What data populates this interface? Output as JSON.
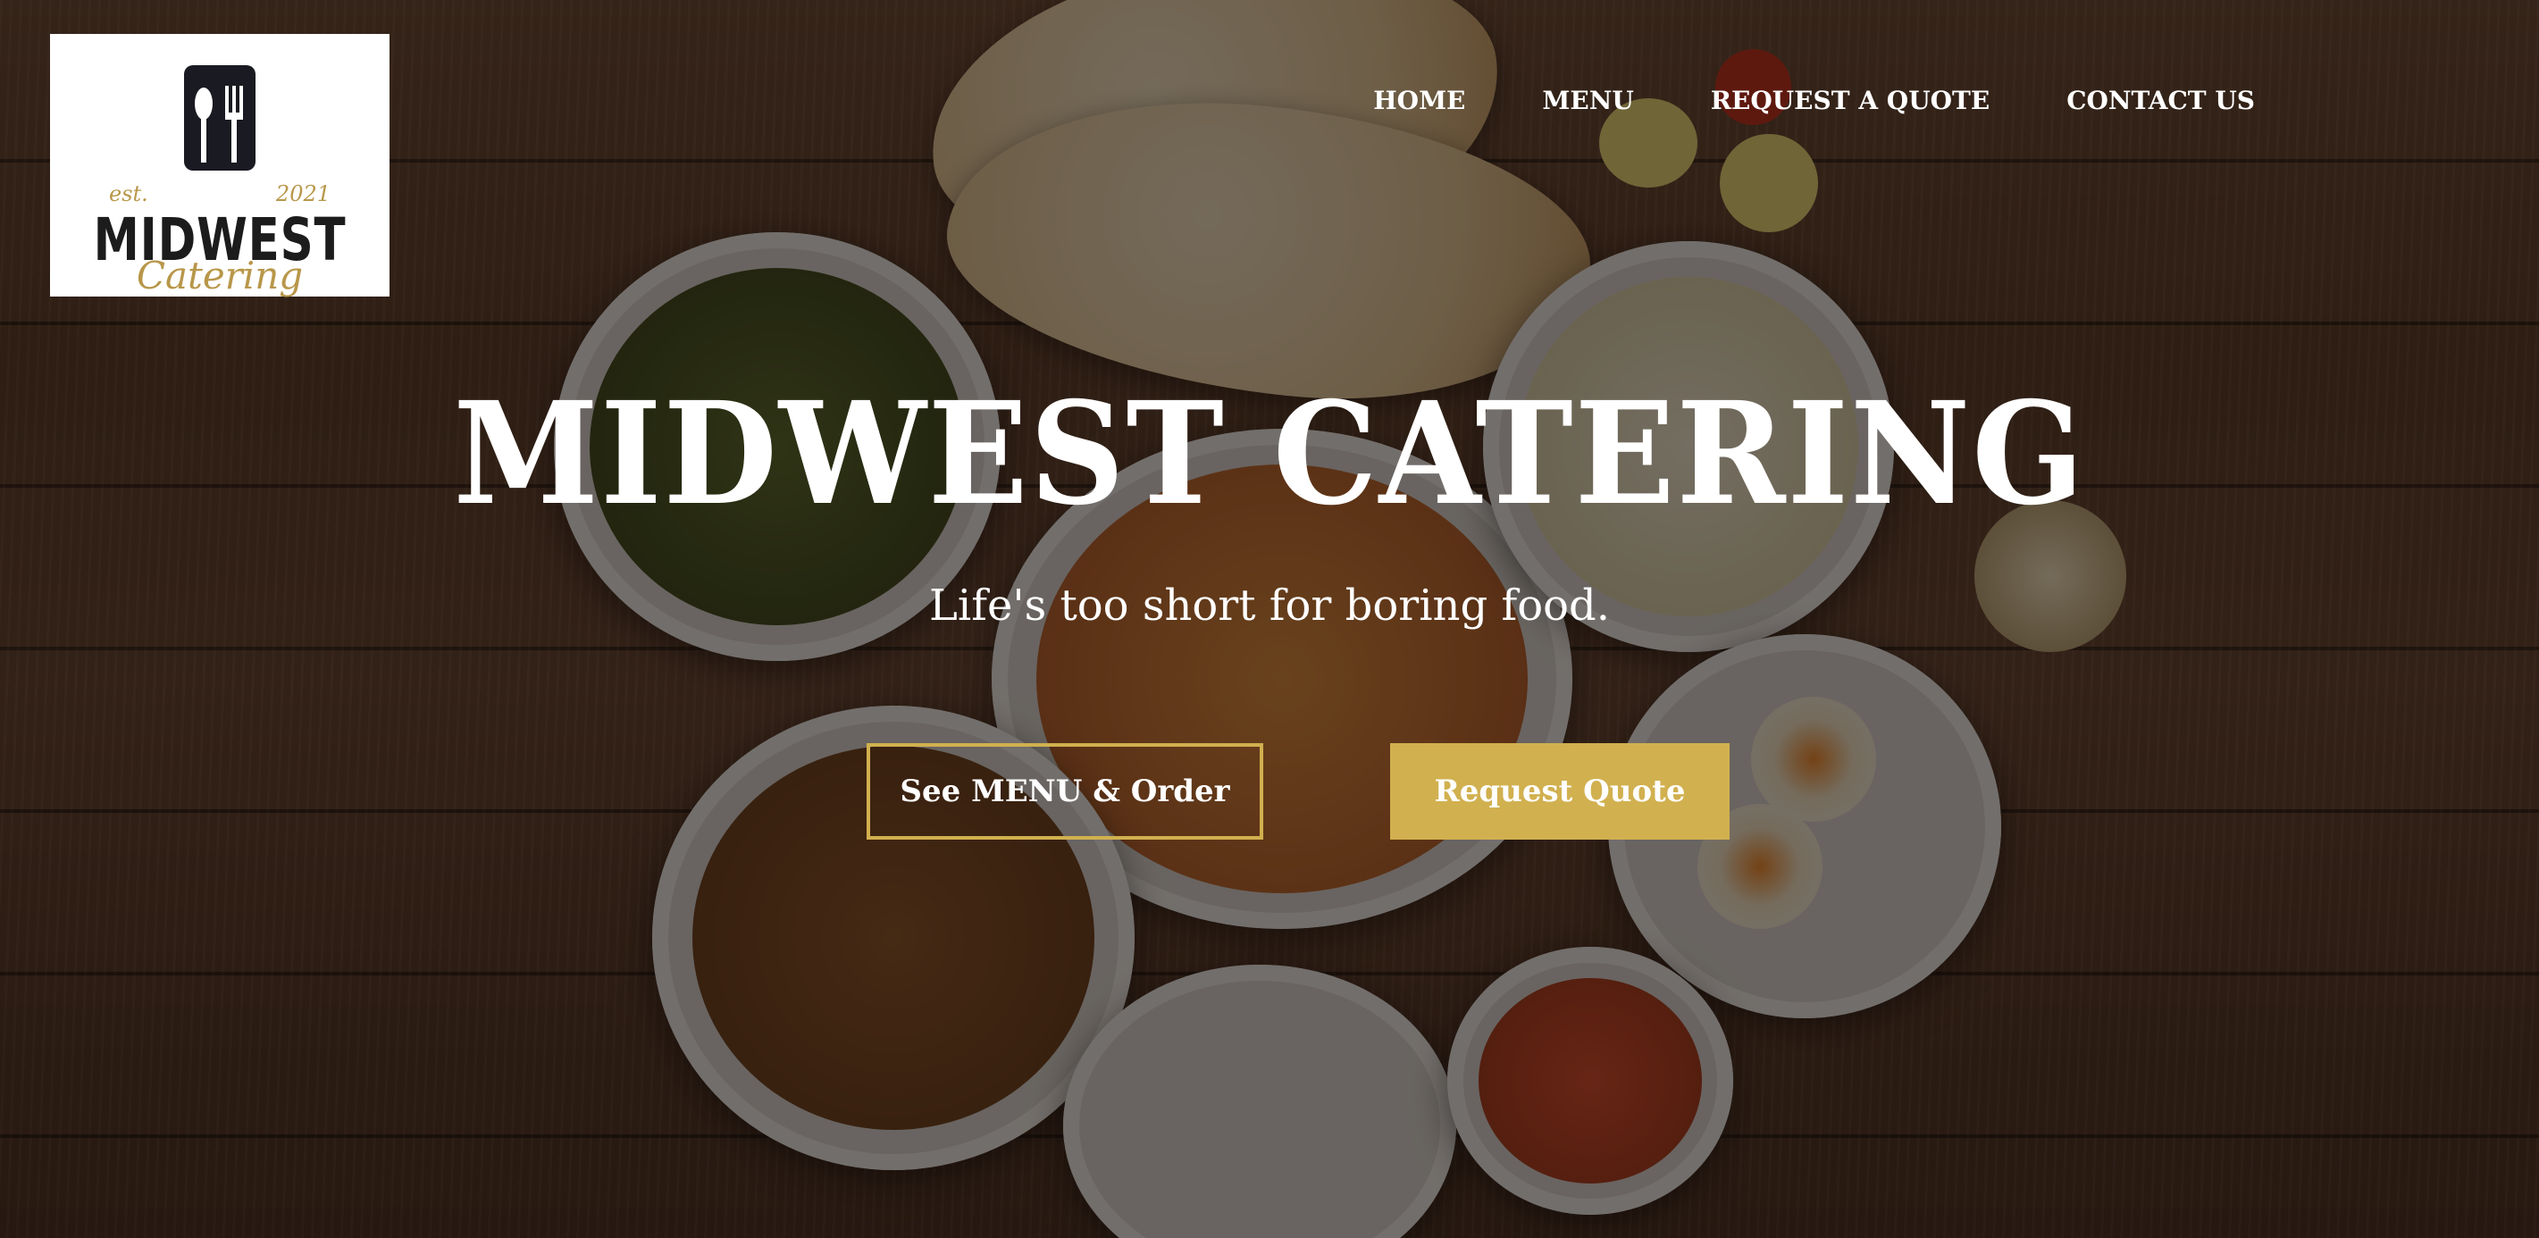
{
  "logo": {
    "brand": "MIDWEST",
    "sub": "Catering",
    "est": "est.",
    "year": "2021"
  },
  "nav": {
    "items": [
      "HOME",
      "MENU",
      "REQUEST A QUOTE",
      "CONTACT US"
    ]
  },
  "hero": {
    "title": "MIDWEST CATERING",
    "tagline": "Life's too short for boring food.",
    "primary_button": "See MENU & Order",
    "secondary_button": "Request Quote"
  },
  "colors": {
    "accent": "#d1b04f",
    "text": "#ffffff"
  }
}
